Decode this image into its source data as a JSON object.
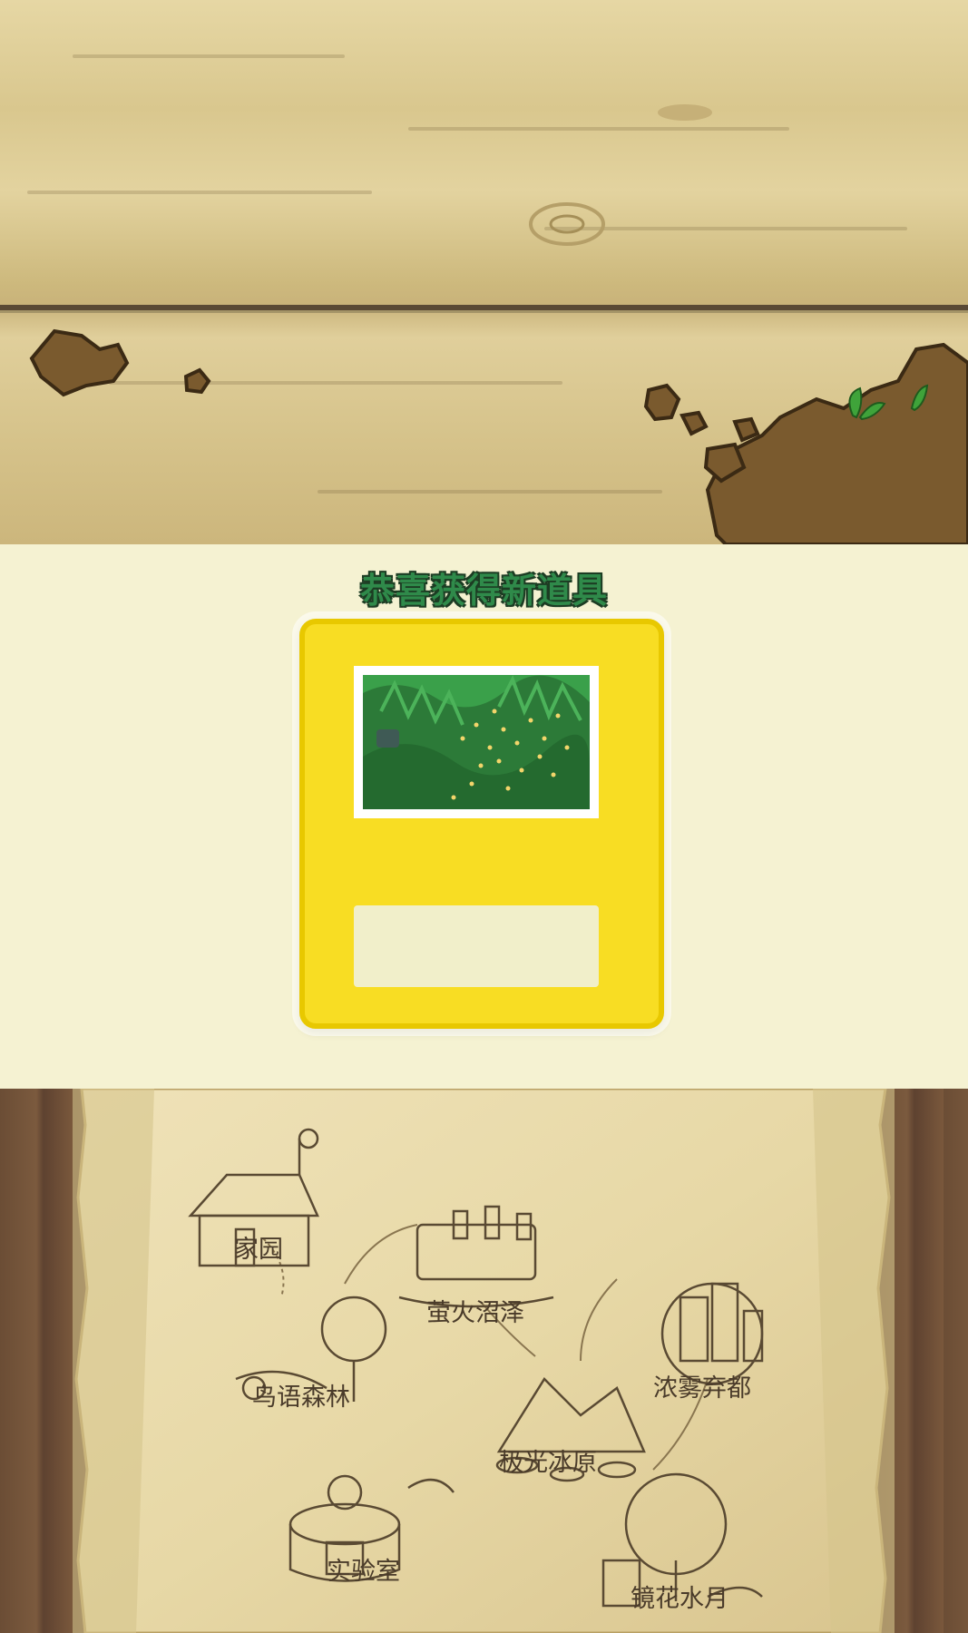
{
  "reward": {
    "title": "恭喜获得新道具",
    "item_name": ""
  },
  "map": {
    "locations": [
      {
        "id": "home",
        "label": "家园"
      },
      {
        "id": "swamp",
        "label": "萤火沼泽"
      },
      {
        "id": "forest",
        "label": "鸟语森林"
      },
      {
        "id": "city",
        "label": "浓雾弃都"
      },
      {
        "id": "glacier",
        "label": "极光冰原"
      },
      {
        "id": "lab",
        "label": "实验室"
      },
      {
        "id": "mirror",
        "label": "镜花水月"
      }
    ]
  },
  "colors": {
    "title_green": "#2f8a4a",
    "card_yellow": "#f8dd23",
    "parchment": "#e9dcb0",
    "wood": "#6b4d35"
  }
}
